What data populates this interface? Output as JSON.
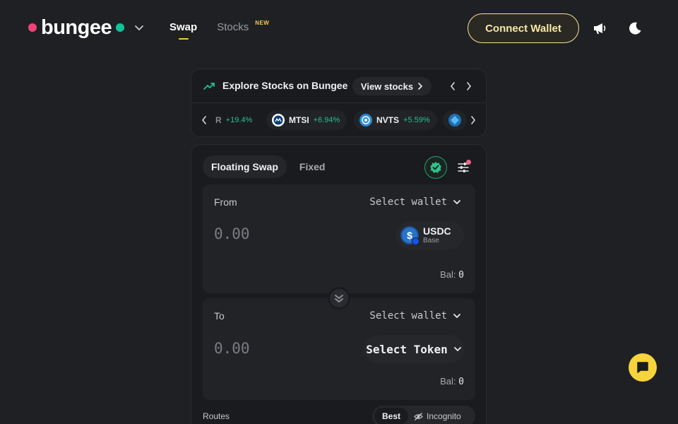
{
  "header": {
    "logo_text": "bungee",
    "nav": [
      {
        "label": "Swap",
        "active": true
      },
      {
        "label": "Stocks",
        "badge": "NEW"
      }
    ],
    "connect_wallet": "Connect Wallet",
    "accent_color": "#f2c94c"
  },
  "stocks_banner": {
    "title": "Explore Stocks on Bungee",
    "view_button": "View stocks",
    "tickers": [
      {
        "symbol": "R",
        "change": "+19.4%"
      },
      {
        "symbol": "MTSI",
        "change": "+6.94%"
      },
      {
        "symbol": "NVTS",
        "change": "+5.59%"
      }
    ]
  },
  "swap": {
    "tabs": [
      "Floating Swap",
      "Fixed"
    ],
    "from": {
      "label": "From",
      "wallet": "Select wallet",
      "amount": "0.00",
      "token": "USDC",
      "chain": "Base",
      "balance_label": "Bal:",
      "balance": "0"
    },
    "to": {
      "label": "To",
      "wallet": "Select wallet",
      "amount": "0.00",
      "token_placeholder": "Select Token",
      "balance_label": "Bal:",
      "balance": "0"
    },
    "routes_label": "Routes",
    "route_modes": [
      "Best",
      "Incognito"
    ]
  }
}
